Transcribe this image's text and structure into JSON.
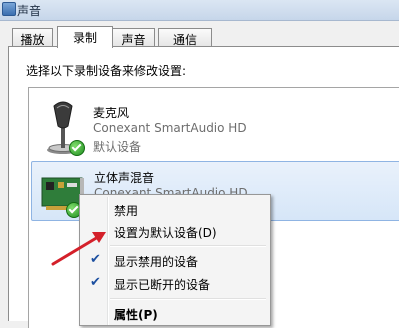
{
  "window": {
    "title": "声音"
  },
  "tabs": [
    {
      "label": "播放"
    },
    {
      "label": "录制"
    },
    {
      "label": "声音"
    },
    {
      "label": "通信"
    }
  ],
  "instruction": "选择以下录制设备来修改设置:",
  "devices": [
    {
      "name": "麦克风",
      "driver": "Conexant SmartAudio HD",
      "status": "默认设备",
      "icon": "microphone-icon"
    },
    {
      "name": "立体声混音",
      "driver": "Conexant SmartAudio HD",
      "status": "",
      "icon": "sound-card-icon"
    }
  ],
  "context_menu": {
    "items": [
      {
        "label": "禁用",
        "checked": false
      },
      {
        "label": "设置为默认设备(D)",
        "checked": false
      },
      {
        "label": "显示禁用的设备",
        "checked": true
      },
      {
        "label": "显示已断开的设备",
        "checked": true
      },
      {
        "label": "属性(P)",
        "checked": false
      }
    ],
    "check_glyph": "✔"
  },
  "colors": {
    "annotation_arrow": "#d4202a",
    "selection": "#d6e6f8"
  }
}
